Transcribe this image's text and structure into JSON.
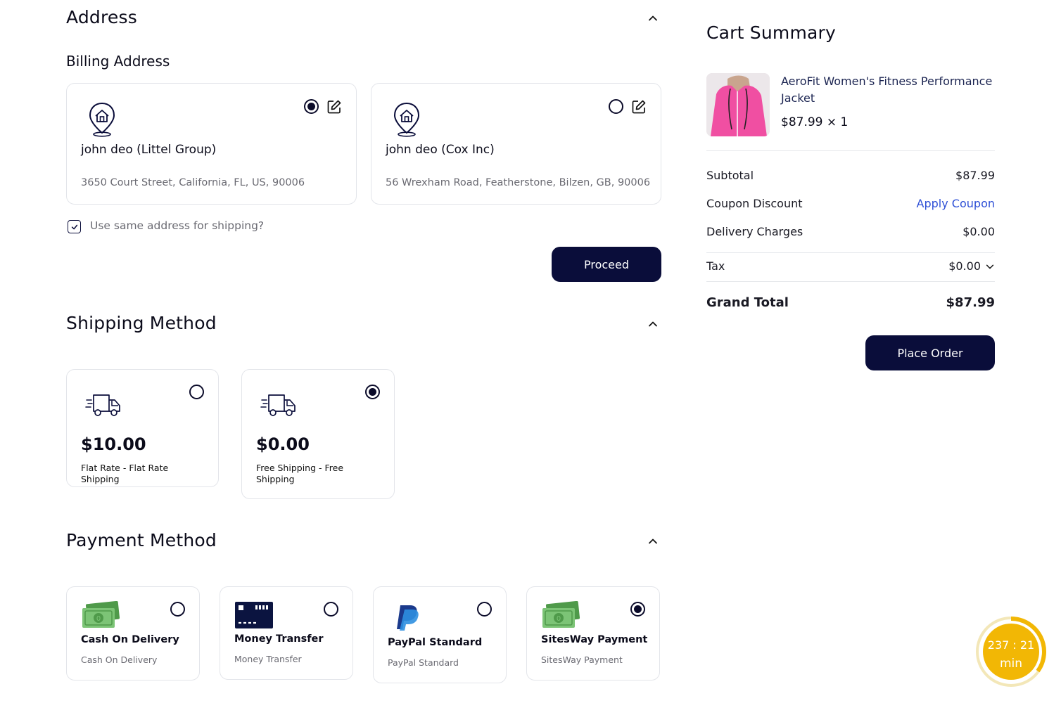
{
  "address": {
    "title": "Address",
    "billing_title": "Billing Address",
    "cards": [
      {
        "name": "john deo (Littel Group)",
        "line": "3650 Court Street, California, FL, US, 90006",
        "selected": true
      },
      {
        "name": "john deo (Cox Inc)",
        "line": "56 Wrexham Road, Featherstone, Bilzen, GB, 90006",
        "selected": false
      }
    ],
    "same_address_label": "Use same address for shipping?",
    "same_address_checked": true,
    "proceed_label": "Proceed"
  },
  "shipping": {
    "title": "Shipping Method",
    "options": [
      {
        "price": "$10.00",
        "label": "Flat Rate - Flat Rate Shipping",
        "selected": false
      },
      {
        "price": "$0.00",
        "label": "Free Shipping - Free Shipping",
        "selected": true
      }
    ]
  },
  "payment": {
    "title": "Payment Method",
    "options": [
      {
        "title": "Cash On Delivery",
        "subtitle": "Cash On Delivery",
        "icon": "cash-icon",
        "selected": false
      },
      {
        "title": "Money Transfer",
        "subtitle": "Money Transfer",
        "icon": "bank-card-icon",
        "selected": false
      },
      {
        "title": "PayPal Standard",
        "subtitle": "PayPal Standard",
        "icon": "paypal-icon",
        "selected": false
      },
      {
        "title": "SitesWay Payment",
        "subtitle": "SitesWay Payment",
        "icon": "cash-icon",
        "selected": true
      }
    ]
  },
  "summary": {
    "title": "Cart Summary",
    "product": {
      "name": "AeroFit Women's Fitness Performance Jacket",
      "price_qty": "$87.99 × 1"
    },
    "subtotal_label": "Subtotal",
    "subtotal_value": "$87.99",
    "coupon_label": "Coupon Discount",
    "coupon_action": "Apply Coupon",
    "delivery_label": "Delivery Charges",
    "delivery_value": "$0.00",
    "tax_label": "Tax",
    "tax_value": "$0.00",
    "grand_total_label": "Grand Total",
    "grand_total_value": "$87.99",
    "place_order_label": "Place Order"
  },
  "timer": {
    "time": "237 : 21",
    "unit": "min",
    "progress": 0.35
  },
  "colors": {
    "primary": "#0a0d3a",
    "link": "#2d4fd6",
    "timer_gold": "#f2b705",
    "money_green": "#6fbf6a",
    "paypal_dark": "#1b3a8c",
    "paypal_light": "#2d8fe0"
  }
}
